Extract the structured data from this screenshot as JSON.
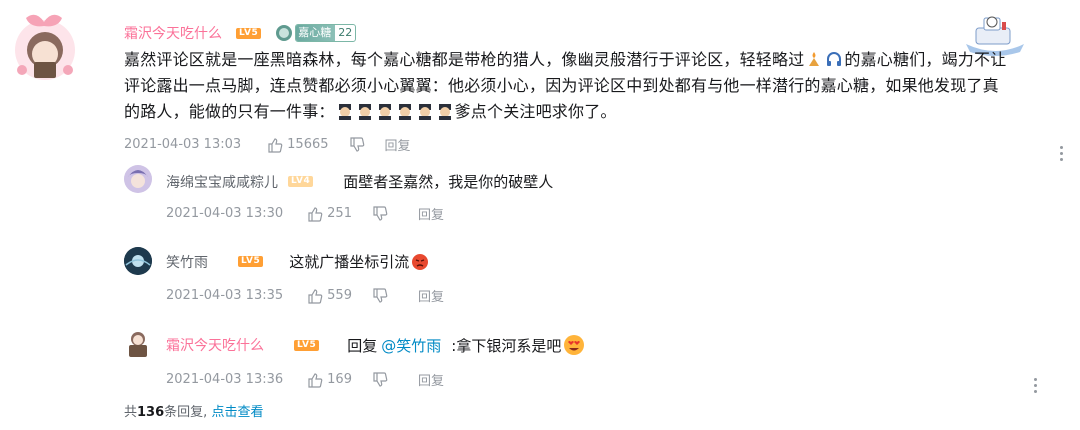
{
  "main_comment": {
    "username": "霜沢今天吃什么",
    "level": "LV5",
    "fan_badge": {
      "name": "嘉心糖",
      "level": "22"
    },
    "text_line1": "嘉然评论区就是一座黑暗森林，每个嘉心糖都是带枪的猎人，像幽灵般潜行于评论区，轻轻略过",
    "text_line1b": "的嘉心糖们，竭力不让",
    "text_line2": "评论露出一点马脚，连点赞都必须小心翼翼：他必须小心，因为评论区中到处都有与他一样潜行的嘉心糖，如果他发现了真",
    "text_line3a": "的路人，能做的只有一件事：",
    "text_line3b": "爹点个关注吧求你了。",
    "time": "2021-04-03 13:03",
    "likes": "15665",
    "reply_label": "回复"
  },
  "replies": [
    {
      "username": "海绵宝宝咸咸粽儿",
      "level": "LV4",
      "text": "面壁者圣嘉然，我是你的破壁人",
      "time": "2021-04-03 13:30",
      "likes": "251",
      "reply_label": "回复"
    },
    {
      "username": "笑竹雨",
      "level": "LV5",
      "text": "这就广播坐标引流",
      "time": "2021-04-03 13:35",
      "likes": "559",
      "reply_label": "回复"
    },
    {
      "username": "霜沢今天吃什么",
      "level": "LV5",
      "reply_prefix": "回复",
      "mention": "@笑竹雨",
      "text": ":拿下银河系是吧",
      "time": "2021-04-03 13:36",
      "likes": "169",
      "reply_label": "回复"
    }
  ],
  "footer": {
    "total_prefix": "共",
    "total_count": "136",
    "total_suffix": "条回复,",
    "view_link": "点击查看"
  },
  "colors": {
    "username_pink": "#fb7299",
    "meta_gray": "#9499a0",
    "link_blue": "#008ac5",
    "level5_orange": "#ff9f34",
    "level4_yellow": "#ffd79a"
  }
}
